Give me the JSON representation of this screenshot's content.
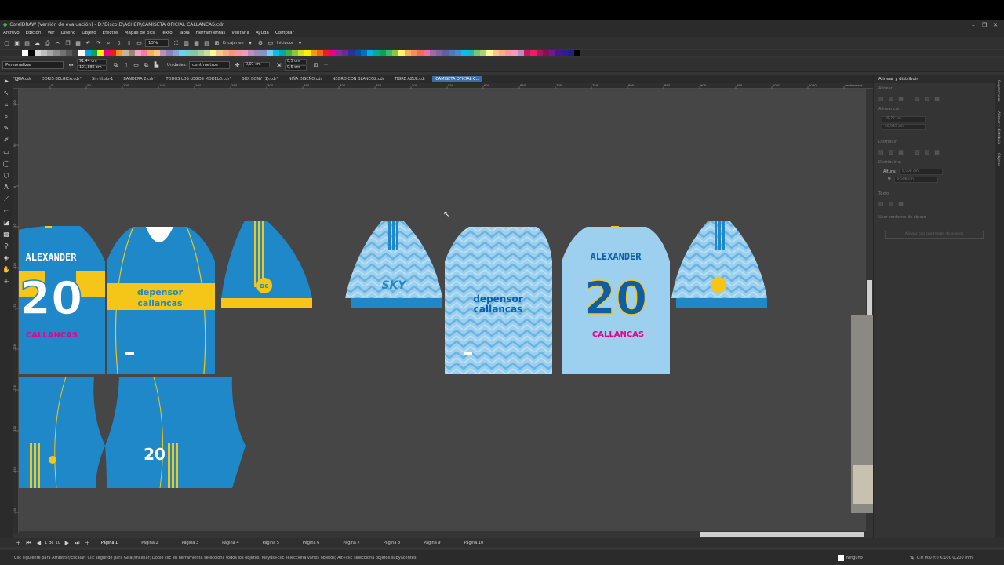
{
  "title_bar": {
    "title": "CorelDRAW (Versión de evaluación) - D:\\Disco D\\ACHER\\CAMISETA OFICIAL CALLANCAS.cdr",
    "minimize": "–",
    "restore": "❐",
    "close": "✕"
  },
  "menu": [
    "Archivo",
    "Edición",
    "Ver",
    "Diseño",
    "Objeto",
    "Efectos",
    "Mapas de bits",
    "Texto",
    "Tabla",
    "Herramientas",
    "Ventana",
    "Ayuda",
    "Comprar"
  ],
  "standard_toolbar": {
    "zoom": "13%",
    "snap": "Encajar en",
    "launch": "Iniciador"
  },
  "palette": [
    "#ffffff",
    "#000000",
    "#d9d9d9",
    "#bfbfbf",
    "#a6a6a6",
    "#8c8c8c",
    "#737373",
    "#595959",
    "#404040",
    "#ffffff",
    "#00a2e8",
    "#00a651",
    "#fff200",
    "#ec008c",
    "#ed1c24",
    "#f7941d",
    "#c7b299",
    "#998675",
    "#ff9ec1",
    "#ff77a8",
    "#fbaf5d",
    "#fdc689",
    "#bd8cbf",
    "#8781bd",
    "#7da7d9",
    "#6dcff6",
    "#7accc8",
    "#82ca9c",
    "#a3d39c",
    "#c4df9b",
    "#fff799",
    "#fdc689",
    "#f9ad81",
    "#f69679",
    "#f5989d",
    "#f49ac1",
    "#bc8dbf",
    "#a187be",
    "#8393ca",
    "#6dcff6",
    "#00bff3",
    "#00a99d",
    "#39b54a",
    "#8dc63f",
    "#d7df23",
    "#fff200",
    "#f7941d",
    "#f26522",
    "#ed1c24",
    "#ec008c",
    "#92278f",
    "#662d91",
    "#2e3192",
    "#0054a6",
    "#0072bc",
    "#00aeef",
    "#00a99d",
    "#00a651",
    "#3cb878",
    "#8dc63f",
    "#fff568",
    "#fbaf5d",
    "#f68e56",
    "#f26c4f",
    "#f06eaa",
    "#a864a8",
    "#8560a8",
    "#605ca8",
    "#5674b9",
    "#448ccb",
    "#00bff3",
    "#1cbbb4",
    "#7cc576",
    "#acd373",
    "#fff799",
    "#fdc689",
    "#f9ad81",
    "#f5989d",
    "#f49ac1",
    "#bd8cbf",
    "#c2185b",
    "#e91e63",
    "#ad1457",
    "#880e4f",
    "#6a1b9a",
    "#4a148c",
    "#311b92",
    "#1a237e",
    "#000000"
  ],
  "property_bar": {
    "preset": "Personalizar",
    "width": "91,44 cm",
    "height": "121,885 cm",
    "units_label": "Unidades:",
    "units": "centímetros",
    "nudge": "0,01 cm",
    "dup_x": "0,5 cm",
    "dup_y": "0,5 cm"
  },
  "doc_tabs": [
    "FERIA.cdr",
    "DORIS BELGICA.cdr*",
    "Sin título-1",
    "BANDERA 2.cdr*",
    "TODOS LOS LOGOS MODELO.cdr*",
    "BOX BONY (1).cdr*",
    "NIÑA DISEÑO.cdr",
    "NEGRO CON BLANCO2.cdr",
    "TIGRE AZUL.cdr",
    "CAMISETA OFICIAL C..."
  ],
  "ruler_top": [
    "0",
    "50",
    "100",
    "150",
    "200",
    "250",
    "300",
    "350",
    "400",
    "450",
    "500",
    "550",
    "600",
    "650",
    "700",
    "750",
    "800",
    "850",
    "900",
    "950",
    "1000",
    "1050",
    "centímetros"
  ],
  "ruler_left": [
    "100",
    "50",
    "0",
    "-50",
    "-100",
    "-150",
    "-200",
    "-250",
    "-300",
    "-350",
    "-400"
  ],
  "ruler_units": "centímetros",
  "docker": {
    "title": "Alinear y distribuir",
    "align": "Alinear",
    "align_to": "Alinear con:",
    "x": "45,72 cm",
    "y": "60,943 cm",
    "distribute": "Distribuir",
    "distribute_to": "Distribuir a:",
    "height_label": "Altura:",
    "h_value": "0,508 cm",
    "v_label": "V:",
    "v_value": "0,508 cm",
    "text": "Texto",
    "outline_check": "Usar contorno de objeto",
    "pixel_button": "Alinear con cuadrícula de píxeles"
  },
  "side_tabs": [
    "Sugerencias",
    "Alinear y distribuir",
    "Objetos"
  ],
  "designs": {
    "name": "ALEXANDER",
    "number": "20",
    "sponsor_1": "depensor",
    "sponsor_2": "callancas",
    "club": "CALLANCAS",
    "brand": "SKY",
    "badge": "DC"
  },
  "page_nav": {
    "current": "1",
    "of": "de",
    "total": "10"
  },
  "pages": [
    "Página 1",
    "Página 2",
    "Página 3",
    "Página 4",
    "Página 5",
    "Página 6",
    "Página 7",
    "Página 8",
    "Página 9",
    "Página 10"
  ],
  "status": {
    "hint": "Clic siguiente para Arrastrar/Escalar; Clic segundo para Girar/Inclinar; Doble clic en herramienta selecciona todos los objetos; Mayús+clic selecciona varios objetos; Alt+clic selecciona objetos subyacentes",
    "fill": "Ninguno",
    "outline": "C:0 M:0 Y:0 K:100  0,200 mm"
  },
  "colors": {
    "blue": "#1e88c9",
    "light_blue": "#9dd0ee",
    "yellow": "#f5c518",
    "sponsor_blue": "#0d5ea8",
    "accent": "#3d6ea5"
  }
}
